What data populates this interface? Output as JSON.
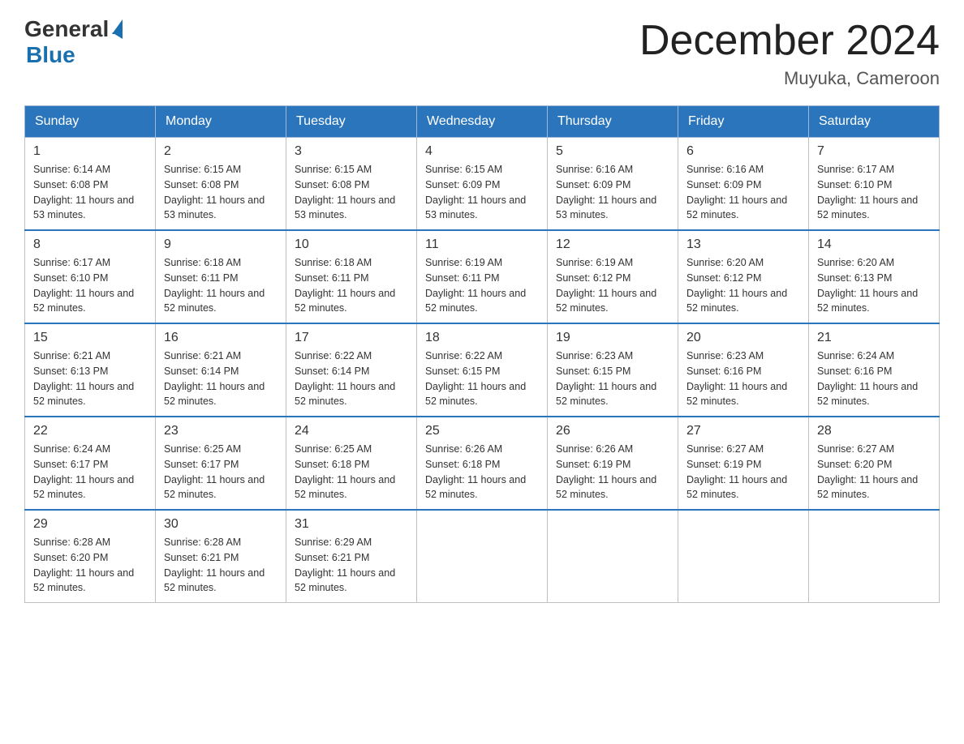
{
  "header": {
    "logo_general": "General",
    "logo_blue": "Blue",
    "month_year": "December 2024",
    "location": "Muyuka, Cameroon"
  },
  "days_of_week": [
    "Sunday",
    "Monday",
    "Tuesday",
    "Wednesday",
    "Thursday",
    "Friday",
    "Saturday"
  ],
  "weeks": [
    [
      {
        "day": "1",
        "sunrise": "6:14 AM",
        "sunset": "6:08 PM",
        "daylight": "11 hours and 53 minutes."
      },
      {
        "day": "2",
        "sunrise": "6:15 AM",
        "sunset": "6:08 PM",
        "daylight": "11 hours and 53 minutes."
      },
      {
        "day": "3",
        "sunrise": "6:15 AM",
        "sunset": "6:08 PM",
        "daylight": "11 hours and 53 minutes."
      },
      {
        "day": "4",
        "sunrise": "6:15 AM",
        "sunset": "6:09 PM",
        "daylight": "11 hours and 53 minutes."
      },
      {
        "day": "5",
        "sunrise": "6:16 AM",
        "sunset": "6:09 PM",
        "daylight": "11 hours and 53 minutes."
      },
      {
        "day": "6",
        "sunrise": "6:16 AM",
        "sunset": "6:09 PM",
        "daylight": "11 hours and 52 minutes."
      },
      {
        "day": "7",
        "sunrise": "6:17 AM",
        "sunset": "6:10 PM",
        "daylight": "11 hours and 52 minutes."
      }
    ],
    [
      {
        "day": "8",
        "sunrise": "6:17 AM",
        "sunset": "6:10 PM",
        "daylight": "11 hours and 52 minutes."
      },
      {
        "day": "9",
        "sunrise": "6:18 AM",
        "sunset": "6:11 PM",
        "daylight": "11 hours and 52 minutes."
      },
      {
        "day": "10",
        "sunrise": "6:18 AM",
        "sunset": "6:11 PM",
        "daylight": "11 hours and 52 minutes."
      },
      {
        "day": "11",
        "sunrise": "6:19 AM",
        "sunset": "6:11 PM",
        "daylight": "11 hours and 52 minutes."
      },
      {
        "day": "12",
        "sunrise": "6:19 AM",
        "sunset": "6:12 PM",
        "daylight": "11 hours and 52 minutes."
      },
      {
        "day": "13",
        "sunrise": "6:20 AM",
        "sunset": "6:12 PM",
        "daylight": "11 hours and 52 minutes."
      },
      {
        "day": "14",
        "sunrise": "6:20 AM",
        "sunset": "6:13 PM",
        "daylight": "11 hours and 52 minutes."
      }
    ],
    [
      {
        "day": "15",
        "sunrise": "6:21 AM",
        "sunset": "6:13 PM",
        "daylight": "11 hours and 52 minutes."
      },
      {
        "day": "16",
        "sunrise": "6:21 AM",
        "sunset": "6:14 PM",
        "daylight": "11 hours and 52 minutes."
      },
      {
        "day": "17",
        "sunrise": "6:22 AM",
        "sunset": "6:14 PM",
        "daylight": "11 hours and 52 minutes."
      },
      {
        "day": "18",
        "sunrise": "6:22 AM",
        "sunset": "6:15 PM",
        "daylight": "11 hours and 52 minutes."
      },
      {
        "day": "19",
        "sunrise": "6:23 AM",
        "sunset": "6:15 PM",
        "daylight": "11 hours and 52 minutes."
      },
      {
        "day": "20",
        "sunrise": "6:23 AM",
        "sunset": "6:16 PM",
        "daylight": "11 hours and 52 minutes."
      },
      {
        "day": "21",
        "sunrise": "6:24 AM",
        "sunset": "6:16 PM",
        "daylight": "11 hours and 52 minutes."
      }
    ],
    [
      {
        "day": "22",
        "sunrise": "6:24 AM",
        "sunset": "6:17 PM",
        "daylight": "11 hours and 52 minutes."
      },
      {
        "day": "23",
        "sunrise": "6:25 AM",
        "sunset": "6:17 PM",
        "daylight": "11 hours and 52 minutes."
      },
      {
        "day": "24",
        "sunrise": "6:25 AM",
        "sunset": "6:18 PM",
        "daylight": "11 hours and 52 minutes."
      },
      {
        "day": "25",
        "sunrise": "6:26 AM",
        "sunset": "6:18 PM",
        "daylight": "11 hours and 52 minutes."
      },
      {
        "day": "26",
        "sunrise": "6:26 AM",
        "sunset": "6:19 PM",
        "daylight": "11 hours and 52 minutes."
      },
      {
        "day": "27",
        "sunrise": "6:27 AM",
        "sunset": "6:19 PM",
        "daylight": "11 hours and 52 minutes."
      },
      {
        "day": "28",
        "sunrise": "6:27 AM",
        "sunset": "6:20 PM",
        "daylight": "11 hours and 52 minutes."
      }
    ],
    [
      {
        "day": "29",
        "sunrise": "6:28 AM",
        "sunset": "6:20 PM",
        "daylight": "11 hours and 52 minutes."
      },
      {
        "day": "30",
        "sunrise": "6:28 AM",
        "sunset": "6:21 PM",
        "daylight": "11 hours and 52 minutes."
      },
      {
        "day": "31",
        "sunrise": "6:29 AM",
        "sunset": "6:21 PM",
        "daylight": "11 hours and 52 minutes."
      },
      null,
      null,
      null,
      null
    ]
  ]
}
